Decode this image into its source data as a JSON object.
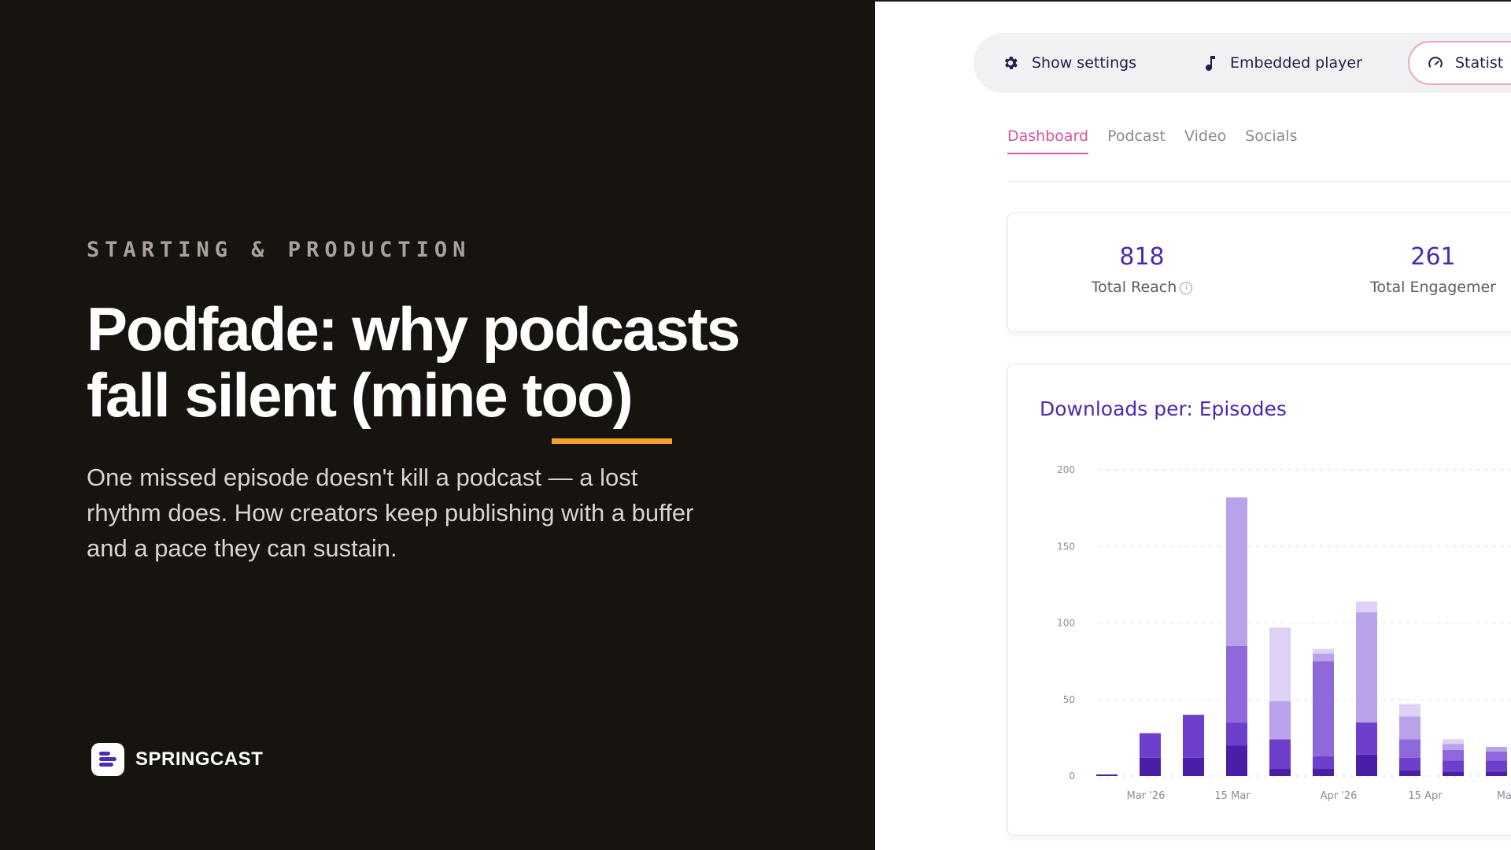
{
  "article": {
    "category": "STARTING & PRODUCTION",
    "title_line1": "Podfade: why podcasts",
    "title_line2_main": "fall silent (mine ",
    "title_line2_emph": "too)",
    "description": "One missed episode doesn't kill a podcast — a lost rhythm does. How creators keep publishing with a buffer and a pace they can sustain.",
    "brand": "SPRINGCAST",
    "accent_color": "#f0a22c"
  },
  "toolbar": {
    "show_settings": {
      "label": "Show settings",
      "icon": "gear-icon"
    },
    "embedded_player": {
      "label": "Embedded player",
      "icon": "music-note-icon"
    },
    "statistics": {
      "label": "Statist",
      "icon": "gauge-icon"
    }
  },
  "tabs": [
    {
      "label": "Dashboard",
      "active": true
    },
    {
      "label": "Podcast",
      "active": false
    },
    {
      "label": "Video",
      "active": false
    },
    {
      "label": "Socials",
      "active": false
    }
  ],
  "kpis": [
    {
      "value": "818",
      "label": "Total Reach"
    },
    {
      "value": "261",
      "label": "Total Engagemer"
    }
  ],
  "chart_data": {
    "type": "bar",
    "stacked": true,
    "title": "Downloads per: Episodes",
    "ylim": [
      0,
      200
    ],
    "y_ticks": [
      "0",
      "50",
      "100",
      "150",
      "200"
    ],
    "x_tick_labels": [
      "Mar '26",
      "15 Mar",
      "Apr '26",
      "15 Apr",
      "May '"
    ],
    "grid": true,
    "colors": [
      "#4a1fa8",
      "#6e3fcc",
      "#8f68db",
      "#b9a2ea",
      "#ddd2f5"
    ],
    "bars": [
      [
        1,
        0,
        0,
        0,
        0
      ],
      [
        12,
        16,
        0,
        0,
        0
      ],
      [
        12,
        28,
        0,
        0,
        0
      ],
      [
        20,
        15,
        50,
        97,
        0
      ],
      [
        5,
        19,
        0,
        25,
        48
      ],
      [
        5,
        8,
        62,
        5,
        3
      ],
      [
        14,
        21,
        0,
        72,
        7
      ],
      [
        4,
        8,
        12,
        15,
        8
      ],
      [
        3,
        7,
        7,
        4,
        3
      ],
      [
        3,
        7,
        6,
        3,
        0
      ]
    ]
  }
}
